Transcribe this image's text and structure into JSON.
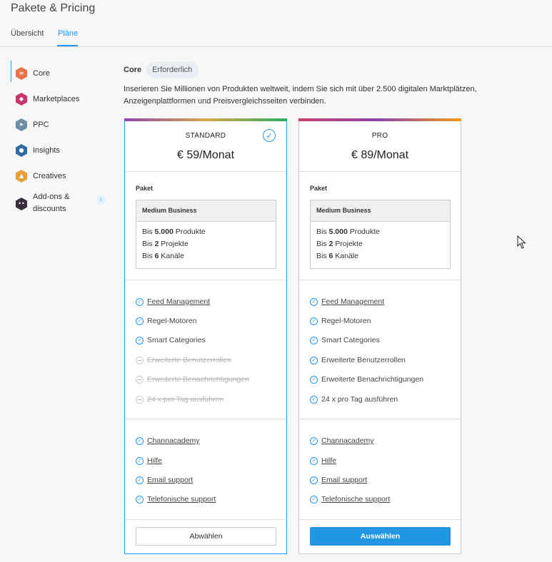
{
  "page": {
    "title": "Pakete & Pricing"
  },
  "tabs": [
    {
      "label": "Übersicht"
    },
    {
      "label": "Pläne"
    }
  ],
  "sidebar": {
    "items": [
      {
        "label": "Core",
        "icon": "core-icon",
        "color": "#e8734a"
      },
      {
        "label": "Marketplaces",
        "icon": "marketplaces-icon",
        "color": "#c8366e"
      },
      {
        "label": "PPC",
        "icon": "ppc-icon",
        "color": "#6b8fa6"
      },
      {
        "label": "Insights",
        "icon": "insights-icon",
        "color": "#2e6da4"
      },
      {
        "label": "Creatives",
        "icon": "creatives-icon",
        "color": "#e8a03a"
      },
      {
        "label_line1": "Add-ons &",
        "label_line2": "discounts",
        "icon": "addons-icon",
        "color": "#3a2b3f"
      }
    ]
  },
  "core": {
    "label": "Core",
    "badge": "Erforderlich"
  },
  "intro": {
    "line1": "Inserieren Sie Millionen von Produkten weltweit, indem Sie sich mit über 2.500 digitalen Marktplätzen,",
    "line2": "Anzeigenplattformen und Preisvergleichsseiten verbinden."
  },
  "plans": [
    {
      "name": "STANDARD",
      "price": "€ 59/Monat",
      "selected": true,
      "paket_label": "Paket",
      "paket_name": "Medium Business",
      "products_pre": "Bis ",
      "products_num": "5.000",
      "products_post": " Produkte",
      "projects_pre": "Bis ",
      "projects_num": "2",
      "projects_post": " Projekte",
      "channels_pre": "Bis ",
      "channels_num": "6",
      "channels_post": " Kanäle",
      "features": [
        {
          "label": "Feed Management",
          "enabled": true
        },
        {
          "label": "Regel-Motoren",
          "enabled": true
        },
        {
          "label": "Smart Categories",
          "enabled": true
        },
        {
          "label": "Erweiterte Benutzerrollen",
          "enabled": false
        },
        {
          "label": "Erweiterte Benachrichtigungen",
          "enabled": false
        },
        {
          "label": "24 x pro Tag ausführen",
          "enabled": false
        }
      ],
      "support": [
        {
          "label": "Channacademy"
        },
        {
          "label": "Hilfe"
        },
        {
          "label": "Email support"
        },
        {
          "label": "Telefonische support"
        }
      ],
      "button": "Abwählen"
    },
    {
      "name": "PRO",
      "price": "€ 89/Monat",
      "selected": false,
      "paket_label": "Paket",
      "paket_name": "Medium Business",
      "products_pre": "Bis ",
      "products_num": "5.000",
      "products_post": " Produkte",
      "projects_pre": "Bis ",
      "projects_num": "2",
      "projects_post": " Projekte",
      "channels_pre": "Bis ",
      "channels_num": "6",
      "channels_post": " Kanäle",
      "features": [
        {
          "label": "Feed Management",
          "enabled": true
        },
        {
          "label": "Regel-Motoren",
          "enabled": true
        },
        {
          "label": "Smart Categories",
          "enabled": true
        },
        {
          "label": "Erweiterte Benutzerrollen",
          "enabled": true
        },
        {
          "label": "Erweiterte Benachrichtigungen",
          "enabled": true
        },
        {
          "label": "24 x pro Tag ausführen",
          "enabled": true
        }
      ],
      "support": [
        {
          "label": "Channacademy"
        },
        {
          "label": "Hilfe"
        },
        {
          "label": "Email support"
        },
        {
          "label": "Telefonische support"
        }
      ],
      "button": "Auswählen"
    }
  ],
  "colors": {
    "accent": "#2196f3",
    "primary_button": "#2196e3"
  }
}
